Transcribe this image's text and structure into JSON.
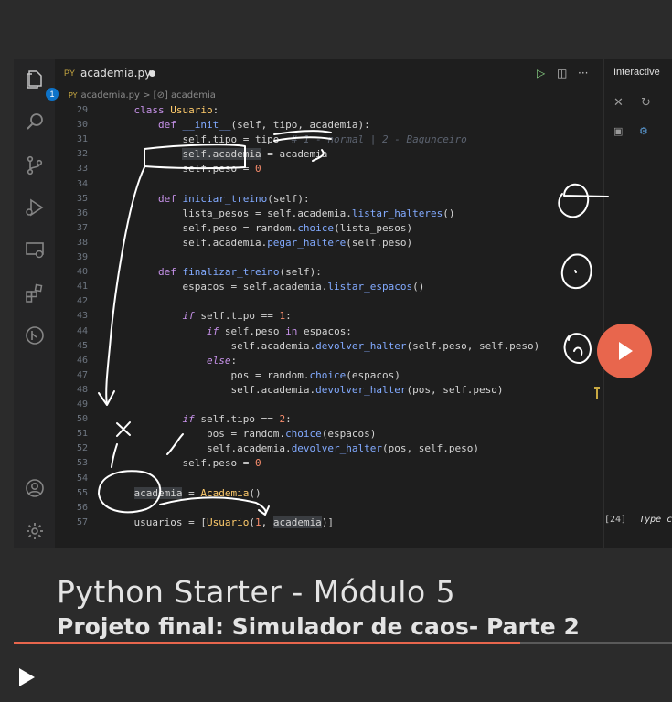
{
  "video": {
    "title": "Python Starter - Módulo 5",
    "subtitle": "Projeto final: Simulador de caos- Parte 2",
    "progress": 0.77,
    "accent_color": "#e8664d"
  },
  "activity_bar": {
    "icons": [
      "explorer-icon",
      "search-icon",
      "source-control-icon",
      "run-debug-icon",
      "remote-explorer-icon",
      "extensions-icon",
      "git-graph-icon",
      "account-icon",
      "settings-gear-icon"
    ],
    "explorer_badge": "1"
  },
  "editor": {
    "tab": {
      "type_label": "PY",
      "filename": "academia.py"
    },
    "breadcrumb": {
      "file_type": "PY",
      "file": "academia.py",
      "separator": ">",
      "symbol": "[⊘] academia"
    },
    "toolbar": {
      "run": "▷",
      "split": "◫",
      "more": "···"
    },
    "lines": [
      {
        "n": "29",
        "code": [
          [
            "",
            "    "
          ],
          [
            "kw",
            "class "
          ],
          [
            "cls",
            "Usuario"
          ],
          [
            "",
            ":"
          ]
        ]
      },
      {
        "n": "30",
        "code": [
          [
            "",
            "        "
          ],
          [
            "kw",
            "def "
          ],
          [
            "fn",
            "__init__"
          ],
          [
            "",
            "(self, tipo, academia):"
          ]
        ]
      },
      {
        "n": "31",
        "code": [
          [
            "",
            "            self.tipo = tipo  "
          ],
          [
            "cm",
            "# 1 - normal | 2 - Bagunceiro"
          ]
        ]
      },
      {
        "n": "32",
        "code": [
          [
            "",
            "            "
          ],
          [
            "hl",
            "self.academia"
          ],
          [
            "",
            " = academia"
          ]
        ]
      },
      {
        "n": "33",
        "code": [
          [
            "",
            "            self.peso = "
          ],
          [
            "num",
            "0"
          ]
        ]
      },
      {
        "n": "34",
        "code": [
          [
            "",
            ""
          ]
        ]
      },
      {
        "n": "35",
        "code": [
          [
            "",
            "        "
          ],
          [
            "kw",
            "def "
          ],
          [
            "fn",
            "iniciar_treino"
          ],
          [
            "",
            "(self):"
          ]
        ]
      },
      {
        "n": "36",
        "code": [
          [
            "",
            "            lista_pesos = self.academia."
          ],
          [
            "fn",
            "listar_halteres"
          ],
          [
            "",
            "()"
          ]
        ]
      },
      {
        "n": "37",
        "code": [
          [
            "",
            "            self.peso = random."
          ],
          [
            "fn",
            "choice"
          ],
          [
            "",
            "(lista_pesos)"
          ]
        ]
      },
      {
        "n": "38",
        "code": [
          [
            "",
            "            self.academia."
          ],
          [
            "fn",
            "pegar_haltere"
          ],
          [
            "",
            "(self.peso)"
          ]
        ]
      },
      {
        "n": "39",
        "code": [
          [
            "",
            ""
          ]
        ]
      },
      {
        "n": "40",
        "code": [
          [
            "",
            "        "
          ],
          [
            "kw",
            "def "
          ],
          [
            "fn",
            "finalizar_treino"
          ],
          [
            "",
            "(self):"
          ]
        ]
      },
      {
        "n": "41",
        "code": [
          [
            "",
            "            espacos = self.academia."
          ],
          [
            "fn",
            "listar_espacos"
          ],
          [
            "",
            "()"
          ]
        ]
      },
      {
        "n": "42",
        "code": [
          [
            "",
            ""
          ]
        ]
      },
      {
        "n": "43",
        "code": [
          [
            "",
            "            "
          ],
          [
            "it",
            "if "
          ],
          [
            "",
            "self.tipo == "
          ],
          [
            "num",
            "1"
          ],
          [
            "",
            ":"
          ]
        ]
      },
      {
        "n": "44",
        "code": [
          [
            "",
            "                "
          ],
          [
            "it",
            "if "
          ],
          [
            "",
            "self.peso "
          ],
          [
            "kw",
            "in "
          ],
          [
            "",
            "espacos:"
          ]
        ]
      },
      {
        "n": "45",
        "code": [
          [
            "",
            "                    self.academia."
          ],
          [
            "fn",
            "devolver_halter"
          ],
          [
            "",
            "(self.peso, self.peso)"
          ]
        ]
      },
      {
        "n": "46",
        "code": [
          [
            "",
            "                "
          ],
          [
            "it",
            "else"
          ],
          [
            "",
            ":"
          ]
        ]
      },
      {
        "n": "47",
        "code": [
          [
            "",
            "                    pos = random."
          ],
          [
            "fn",
            "choice"
          ],
          [
            "",
            "(espacos)"
          ]
        ]
      },
      {
        "n": "48",
        "code": [
          [
            "",
            "                    self.academia."
          ],
          [
            "fn",
            "devolver_halter"
          ],
          [
            "",
            "(pos, self.peso)"
          ]
        ]
      },
      {
        "n": "49",
        "code": [
          [
            "",
            ""
          ]
        ]
      },
      {
        "n": "50",
        "code": [
          [
            "",
            "            "
          ],
          [
            "it",
            "if "
          ],
          [
            "",
            "self.tipo == "
          ],
          [
            "num",
            "2"
          ],
          [
            "",
            ":"
          ]
        ]
      },
      {
        "n": "51",
        "code": [
          [
            "",
            "                pos = random."
          ],
          [
            "fn",
            "choice"
          ],
          [
            "",
            "(espacos)"
          ]
        ]
      },
      {
        "n": "52",
        "code": [
          [
            "",
            "                self.academia."
          ],
          [
            "fn",
            "devolver_halter"
          ],
          [
            "",
            "(pos, self.peso)"
          ]
        ]
      },
      {
        "n": "53",
        "code": [
          [
            "",
            "            self.peso = "
          ],
          [
            "num",
            "0"
          ]
        ]
      },
      {
        "n": "54",
        "code": [
          [
            "",
            ""
          ]
        ]
      },
      {
        "n": "55",
        "code": [
          [
            "",
            "    "
          ],
          [
            "hl",
            "academia"
          ],
          [
            "",
            " = "
          ],
          [
            "cls",
            "Academia"
          ],
          [
            "",
            "()"
          ]
        ]
      },
      {
        "n": "56",
        "code": [
          [
            "",
            ""
          ]
        ]
      },
      {
        "n": "57",
        "code": [
          [
            "",
            "    usuarios = ["
          ],
          [
            "cls",
            "Usuario"
          ],
          [
            "",
            "("
          ],
          [
            "num",
            "1"
          ],
          [
            "",
            ", "
          ],
          [
            "hl",
            "academia"
          ],
          [
            "",
            ")]"
          ]
        ]
      }
    ]
  },
  "interactive_panel": {
    "title": "Interactive",
    "output_prompt": "[24]",
    "output_hint": "Type c"
  }
}
